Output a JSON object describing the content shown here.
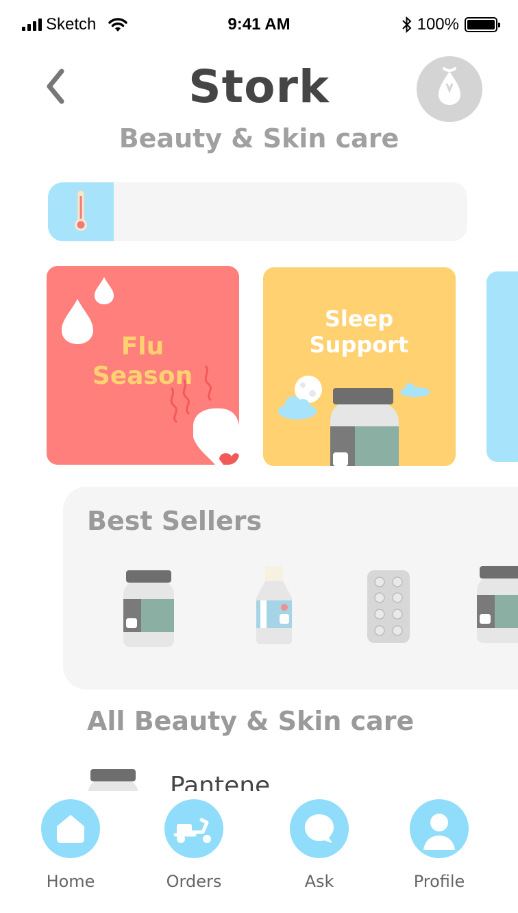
{
  "status_bar": {
    "carrier": "Sketch",
    "time": "9:41 AM",
    "battery": "100%"
  },
  "header": {
    "title": "Stork",
    "subtitle": "Beauty & Skin care"
  },
  "search": {
    "placeholder": ""
  },
  "categories": [
    {
      "label_line1": "Flu",
      "label_line2": "Season",
      "color": "#ff7f7c",
      "text_color": "#ffd170"
    },
    {
      "label_line1": "Sleep",
      "label_line2": "Support",
      "color": "#ffd170",
      "text_color": "#ffffff"
    },
    {
      "color": "#a7e4fb"
    }
  ],
  "best_sellers": {
    "title": "Best Sellers"
  },
  "all_products": {
    "title": "All Beauty & Skin care",
    "items": [
      {
        "name": "Pantene"
      }
    ]
  },
  "nav": [
    {
      "label": "Home",
      "icon": "home-icon"
    },
    {
      "label": "Orders",
      "icon": "scooter-icon"
    },
    {
      "label": "Ask",
      "icon": "chat-bubble-icon"
    },
    {
      "label": "Profile",
      "icon": "profile-icon"
    }
  ],
  "colors": {
    "accent": "#8fdcfb",
    "panel": "#f5f5f5",
    "heading": "#454545",
    "muted": "#9a9a9a"
  }
}
